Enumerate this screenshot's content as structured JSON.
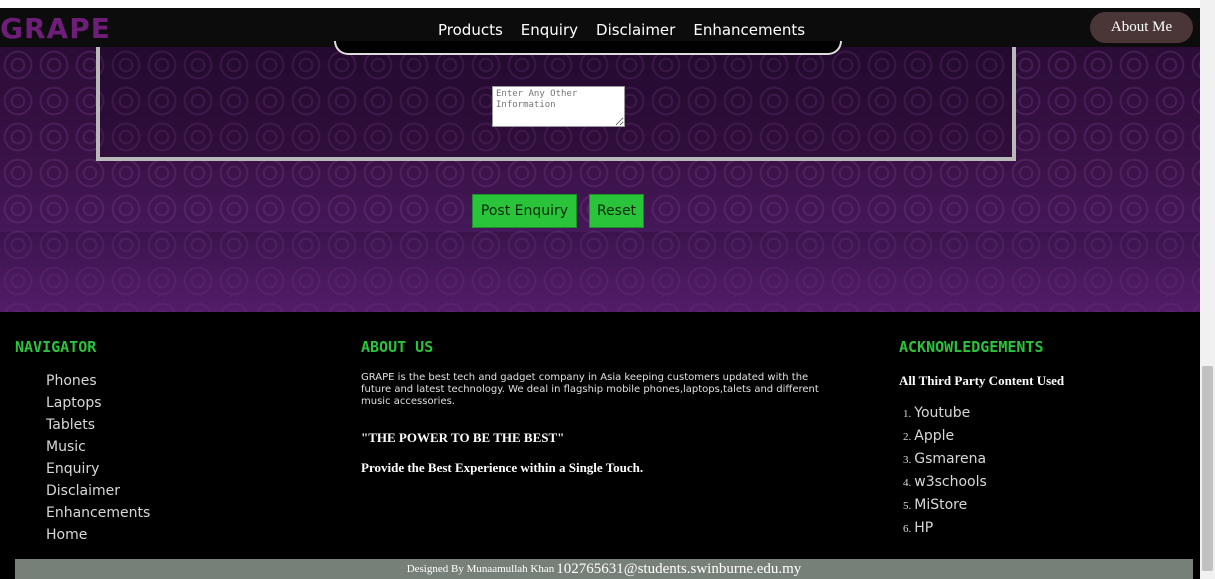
{
  "header": {
    "logo": "GRAPE",
    "nav": [
      "Products",
      "Enquiry",
      "Disclaimer",
      "Enhancements"
    ],
    "about_button": "About Me"
  },
  "form": {
    "info_placeholder": "Enter Any Other Information",
    "post_button": "Post Enquiry",
    "reset_button": "Reset"
  },
  "footer": {
    "navigator": {
      "heading": "NAVIGATOR",
      "items": [
        "Phones",
        "Laptops",
        "Tablets",
        "Music",
        "Enquiry",
        "Disclaimer",
        "Enhancements",
        "Home"
      ]
    },
    "about": {
      "heading": "ABOUT US",
      "text": "GRAPE is the best tech and gadget company in Asia keeping customers updated with the future and latest technology. We deal in flagship mobile phones,laptops,talets and different music accessories.",
      "motto": "\"THE POWER TO BE THE BEST\"",
      "tagline": "Provide the Best Experience within a Single Touch."
    },
    "acknowledgements": {
      "heading": "ACKNOWLEDGEMENTS",
      "subheading": "All Third Party Content Used",
      "items": [
        {
          "num": "1.",
          "label": "Youtube"
        },
        {
          "num": "2.",
          "label": "Apple"
        },
        {
          "num": "3.",
          "label": "Gsmarena"
        },
        {
          "num": "4.",
          "label": "w3schools"
        },
        {
          "num": "5.",
          "label": "MiStore"
        },
        {
          "num": "6.",
          "label": "HP"
        }
      ]
    },
    "credit": {
      "prefix": "Designed By Munaamullah Khan",
      "email": "102765631@students.swinburne.edu.my"
    }
  },
  "colors": {
    "accent_green": "#2ac43a",
    "logo_purple": "#6e1e78"
  }
}
